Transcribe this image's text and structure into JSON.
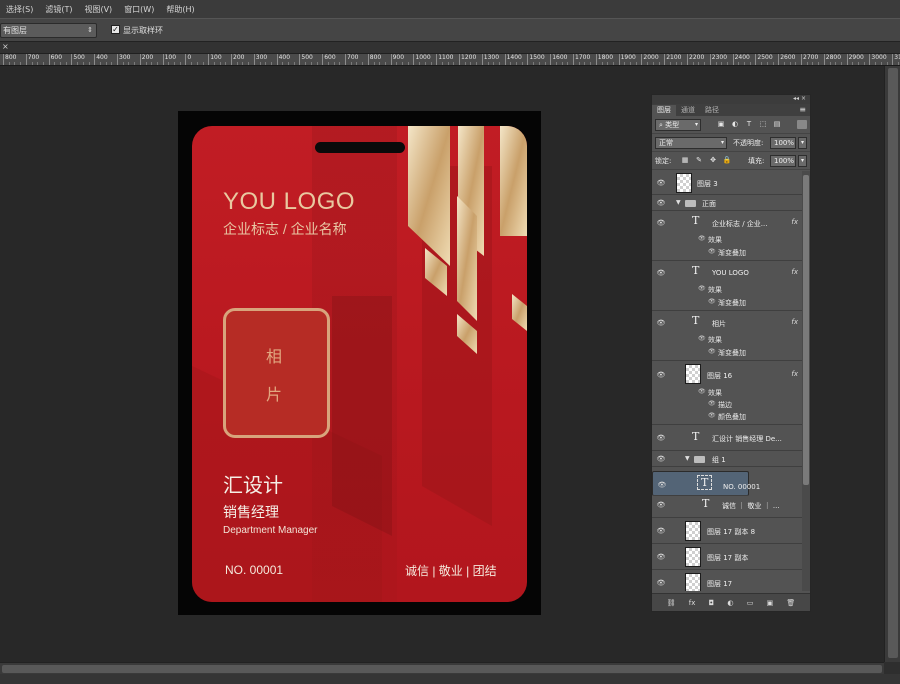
{
  "menu": [
    "选择(S)",
    "滤镜(T)",
    "视图(V)",
    "窗口(W)",
    "帮助(H)"
  ],
  "options": {
    "sample_select": "有图层",
    "show_ring_label": "显示取样环",
    "show_ring_checked": "✓"
  },
  "ruler_labels": [
    "800",
    "700",
    "600",
    "500",
    "400",
    "300",
    "200",
    "100",
    "0",
    "100",
    "200",
    "300",
    "400",
    "500",
    "600",
    "700",
    "800",
    "900",
    "1000",
    "1100",
    "1200",
    "1300",
    "1400",
    "1500",
    "1600",
    "1700",
    "1800",
    "1900",
    "2000",
    "2100",
    "2200",
    "2300",
    "2400",
    "2500",
    "2600",
    "2700",
    "2800",
    "2900",
    "3000",
    "3100"
  ],
  "card": {
    "logo": "YOU LOGO",
    "logo_sub": "企业标志 / 企业名称",
    "photo_1": "相",
    "photo_2": "片",
    "name": "汇设计",
    "title": "销售经理",
    "dept": "Department Manager",
    "number": "NO. 00001",
    "values": "诚信 | 敬业 | 团结",
    "colors": {
      "red": "#c11d24",
      "gold": "#e8c6a3",
      "black": "#050505"
    }
  },
  "panel": {
    "tabs": [
      "图层",
      "通道",
      "路径"
    ],
    "filter_kind": "类型",
    "blend_mode": "正常",
    "opacity_label": "不透明度:",
    "opacity_value": "100%",
    "lock_label": "锁定:",
    "fill_label": "填充:",
    "fill_value": "100%",
    "layers": {
      "layer3": "图层 3",
      "group_front": "正面",
      "text_company": "企业标志 / 企业...",
      "text_youlogo": "YOU LOGO",
      "text_photo": "相片",
      "layer16": "图层 16",
      "text_info": "汇设计 销售经理 De...",
      "group1": "组 1",
      "text_no": "NO. 00001",
      "text_values": "诚信 ｜ 敬业 ｜ ...",
      "layer17_copy8": "图层 17 副本 8",
      "layer17_copy": "图层 17 副本",
      "layer17": "图层 17",
      "fx": "fx",
      "effect": "效果",
      "grad_overlay": "渐变叠加",
      "stroke": "描边",
      "color_overlay": "颜色叠加"
    },
    "footer": [
      "⛓",
      "fx",
      "◘",
      "◐",
      "▭",
      "▣",
      "🗑"
    ]
  }
}
